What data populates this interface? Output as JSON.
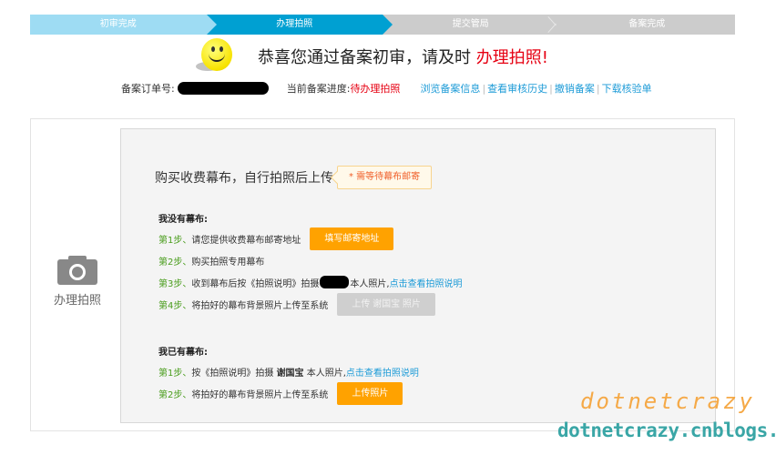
{
  "steps": [
    {
      "label": "初审完成",
      "state": "done"
    },
    {
      "label": "办理拍照",
      "state": "active"
    },
    {
      "label": "提交管局",
      "state": "todo"
    },
    {
      "label": "备案完成",
      "state": "todo"
    }
  ],
  "headline": {
    "text": "恭喜您通过备案初审，请及时",
    "highlight": "办理拍照!"
  },
  "info": {
    "order_label": "备案订单号:",
    "order_value_redacted": true,
    "progress_label": "当前备案进度:",
    "progress_value": "待办理拍照",
    "links": [
      "浏览备案信息",
      "查看审核历史",
      "撤销备案",
      "下载核验单"
    ]
  },
  "left_panel": {
    "icon": "camera-icon",
    "label": "办理拍照"
  },
  "panel": {
    "title": "购买收费幕布，自行拍照后上传",
    "note": "* 需等待幕布邮寄",
    "no_screen": {
      "heading": "我没有幕布:",
      "steps": [
        {
          "no": "第1步、",
          "text": " 请您提供收费幕布邮寄地址",
          "button": "填写邮寄地址"
        },
        {
          "no": "第2步、",
          "text": " 购买拍照专用幕布"
        },
        {
          "no": "第3步、",
          "text_before": "收到幕布后按《拍照说明》拍摄",
          "text_after": "本人照片,",
          "link": "点击查看拍照说明"
        },
        {
          "no": "第4步、",
          "text": "将拍好的幕布背景照片上传至系统",
          "button": "上传 谢国宝 照片",
          "button_disabled": true
        }
      ]
    },
    "have_screen": {
      "heading": "我已有幕布:",
      "steps": [
        {
          "no": "第1步、",
          "text_before": "按《拍照说明》拍摄 ",
          "name": "谢国宝",
          "text_after": " 本人照片,",
          "link": "点击查看拍照说明"
        },
        {
          "no": "第2步、",
          "text": "将拍好的幕布背景照片上传至系统",
          "button": "上传照片"
        }
      ]
    }
  },
  "watermark": {
    "line1": "dotnetcrazy",
    "line2": "dotnetcrazy.cnblogs.com"
  },
  "colors": {
    "step_done": "#9edcf3",
    "step_active": "#00a0d2",
    "step_todo": "#cccccc",
    "highlight_red": "#e60012",
    "link_blue": "#1d9bd7",
    "step_green": "#4a9d1d",
    "button_orange": "#ffa200",
    "note_text": "#f0612c"
  }
}
